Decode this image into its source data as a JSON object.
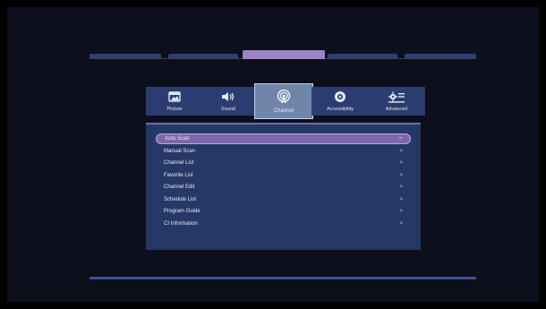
{
  "top_tabs": [
    "tab-1",
    "tab-2",
    "tab-3",
    "tab-4",
    "tab-5"
  ],
  "categories": [
    {
      "label": "Picture",
      "icon": "picture-icon"
    },
    {
      "label": "Sound",
      "icon": "speaker-icon"
    },
    {
      "label": "Channel",
      "icon": "antenna-icon"
    },
    {
      "label": "Accessibility",
      "icon": "eye-icon"
    },
    {
      "label": "Advanced",
      "icon": "advanced-settings-icon"
    }
  ],
  "selected_category": "Channel",
  "menu": {
    "items": [
      {
        "label": "Auto Scan",
        "selected": true
      },
      {
        "label": "Manual Scan"
      },
      {
        "label": "Channel List"
      },
      {
        "label": "Favorite List"
      },
      {
        "label": "Channel Edit"
      },
      {
        "label": "Schedule List"
      },
      {
        "label": "Program Guide"
      },
      {
        "label": "CI Information"
      }
    ],
    "arrow": ">"
  },
  "colors": {
    "background": "#0d0f1c",
    "panel": "#263866",
    "highlight": "#7d67ad",
    "active_tab": "#9b83c6"
  }
}
